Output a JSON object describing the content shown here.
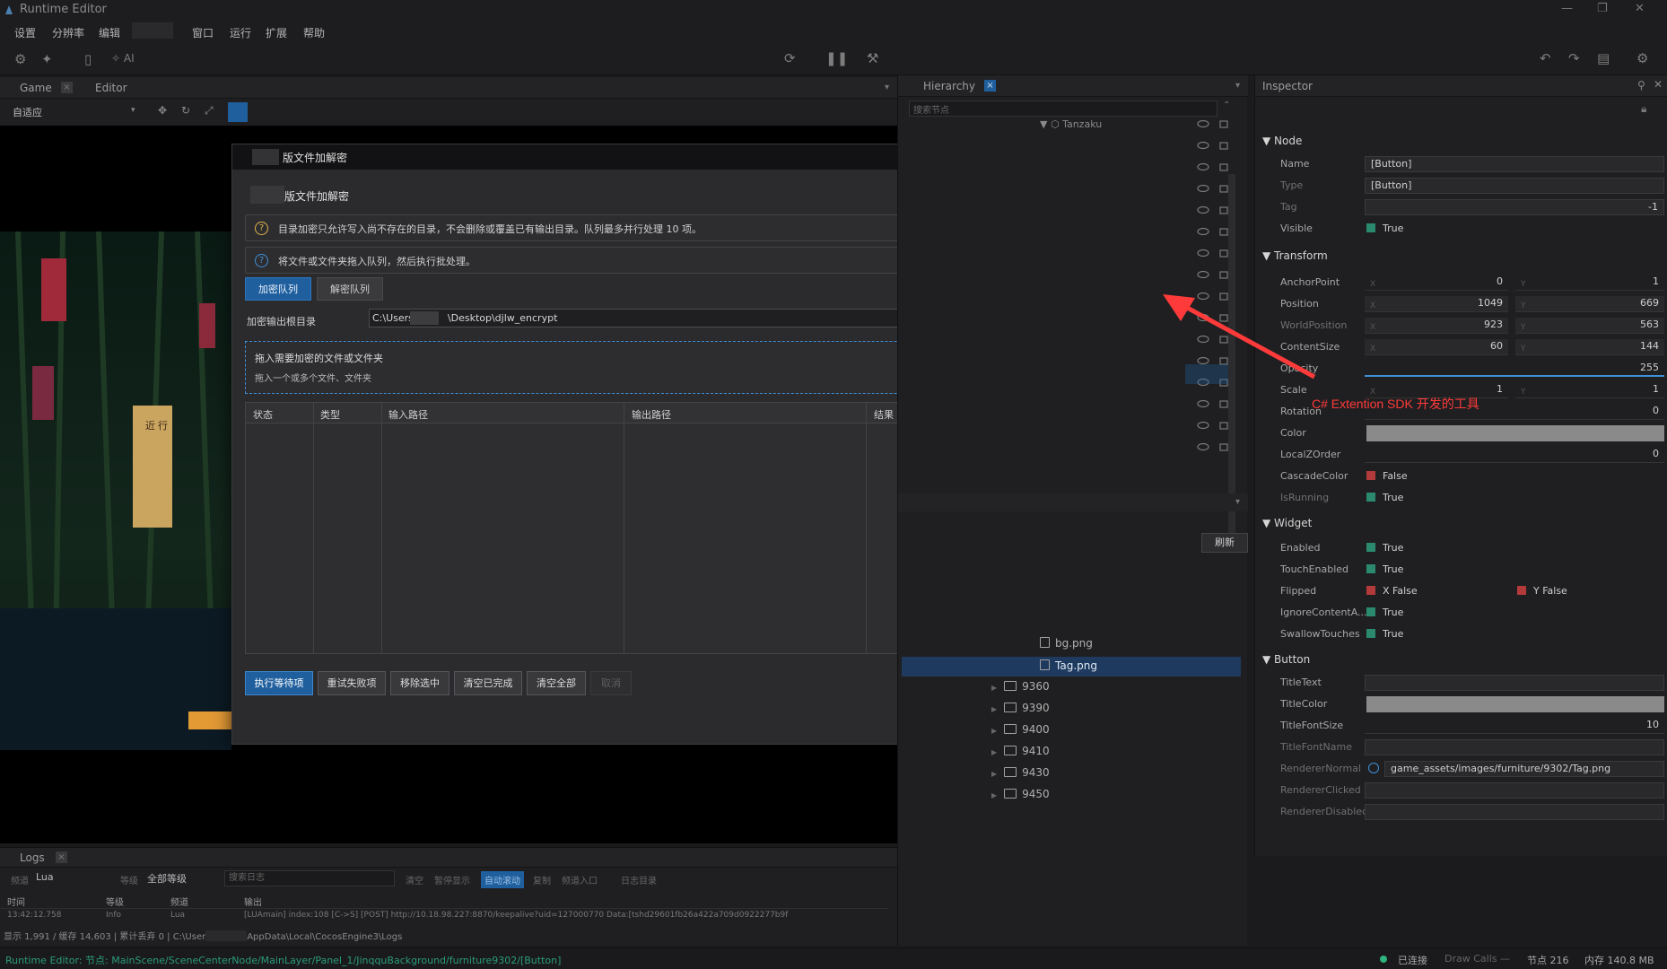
{
  "window": {
    "title": "Runtime Editor",
    "min": "—",
    "max": "❐",
    "close": "✕"
  },
  "menu": {
    "items": [
      "设置",
      "分辨率",
      "编辑",
      "窗口",
      "运行",
      "扩展",
      "帮助"
    ]
  },
  "toolbar": {
    "ai_label": "AI"
  },
  "game_panel": {
    "tabs": [
      "Game",
      "Editor"
    ],
    "resolution_select": "自适应"
  },
  "dialog": {
    "title_suffix": "版文件加解密",
    "heading_suffix": "版文件加解密",
    "close_label": "x",
    "notes": [
      {
        "icon": "?",
        "text": "目录加密只允许写入尚不存在的目录，不会删除或覆盖已有输出目录。队列最多并行处理 10 项。",
        "color": "#e0b54a"
      },
      {
        "icon": "?",
        "text": "将文件或文件夹拖入队列，然后执行批处理。",
        "color": "#3f8fd6"
      }
    ],
    "tabs": [
      "加密队列",
      "解密队列"
    ],
    "active_tab": 0,
    "output_label": "加密输出根目录",
    "output_path_prefix": "C:\\Users",
    "output_path_suffix": "\\Desktop\\djlw_encrypt",
    "drop_title": "拖入需要加密的文件或文件夹",
    "drop_sub": "拖入一个或多个文件、文件夹",
    "columns": [
      "状态",
      "类型",
      "输入路径",
      "输出路径",
      "结果"
    ],
    "buttons": [
      "执行等待项",
      "重试失败项",
      "移除选中",
      "清空已完成",
      "清空全部",
      "取消"
    ]
  },
  "hierarchy": {
    "title": "Hierarchy",
    "search_placeholder": "搜索节点",
    "root_node": "Tanzaku",
    "refresh_label": "刷新",
    "files": [
      "bg.png",
      "Tag.png"
    ],
    "folders": [
      "9360",
      "9390",
      "9400",
      "9410",
      "9430",
      "9450"
    ]
  },
  "inspector": {
    "title": "Inspector",
    "node": {
      "section": "Node",
      "name_label": "Name",
      "name": "[Button]",
      "type_label": "Type",
      "type": "[Button]",
      "tag_label": "Tag",
      "tag": "-1",
      "visible_label": "Visible",
      "visible": "True"
    },
    "transform": {
      "section": "Transform",
      "anchor_label": "AnchorPoint",
      "anchor_x": "0",
      "anchor_y": "1",
      "position_label": "Position",
      "position_x": "1049",
      "position_y": "669",
      "world_label": "WorldPosition",
      "world_x": "923",
      "world_y": "563",
      "size_label": "ContentSize",
      "size_w": "60",
      "size_h": "144",
      "opacity_label": "Opacity",
      "opacity": "255",
      "scale_label": "Scale",
      "scale_x": "1",
      "scale_y": "1",
      "rotation_label": "Rotation",
      "rotation": "0",
      "color_label": "Color",
      "zorder_label": "LocalZOrder",
      "zorder": "0",
      "cascade_label": "CascadeColor",
      "cascade": "False",
      "running_label": "IsRunning",
      "running": "True"
    },
    "widget": {
      "section": "Widget",
      "enabled_label": "Enabled",
      "enabled": "True",
      "touch_label": "TouchEnabled",
      "touch": "True",
      "flipped_label": "Flipped",
      "flip_x": "X False",
      "flip_y": "Y False",
      "ignore_label": "IgnoreContentA...",
      "ignore": "True",
      "swallow_label": "SwallowTouches",
      "swallow": "True"
    },
    "button": {
      "section": "Button",
      "title_text_label": "TitleText",
      "title_color_label": "TitleColor",
      "font_size_label": "TitleFontSize",
      "font_size": "10",
      "font_name_label": "TitleFontName",
      "normal_label": "RendererNormal",
      "normal": "game_assets/images/furniture/9302/Tag.png",
      "clicked_label": "RendererClicked",
      "disabled_label": "RendererDisabled"
    }
  },
  "logs": {
    "tab": "Logs",
    "channel_label": "频道",
    "channel": "Lua",
    "level_label": "等级",
    "level": "全部等级",
    "search_placeholder": "搜索日志",
    "actions": [
      "清空",
      "暂停显示",
      "自动滚动",
      "复制",
      "频道入口",
      "日志目录"
    ],
    "columns": [
      "时间",
      "等级",
      "频道",
      "输出"
    ],
    "first_time": "13:42:12.758",
    "first_level": "Info",
    "first_channel": "Lua",
    "first_output": "[LUAmain] index:108 [C->S] [POST] http://10.18.98.227:8870/keepalive?uid=127000770 Data:[tshd29601fb26a422a709d0922277b9f",
    "stats": "显示 1,991 / 缓存 14,603 | 累计丢弃 0 | C:\\User",
    "stats_path": "AppData\\Local\\CocosEngine3\\Logs"
  },
  "status": {
    "path": "Runtime Editor: 节点: MainScene/SceneCenterNode/MainLayer/Panel_1/JinqquBackground/furniture9302/[Button]",
    "connected": "已连接",
    "draw_calls": "Draw Calls —",
    "nodes": "节点 216",
    "memory": "内存 140.8 MB"
  },
  "annotation": {
    "text": "C# Extention SDK 开发的工具",
    "color": "#ff3a3a"
  },
  "colors": {
    "accent": "#1f5f9e",
    "check_green": "#2b8a6e",
    "check_red": "#b33a3a"
  }
}
